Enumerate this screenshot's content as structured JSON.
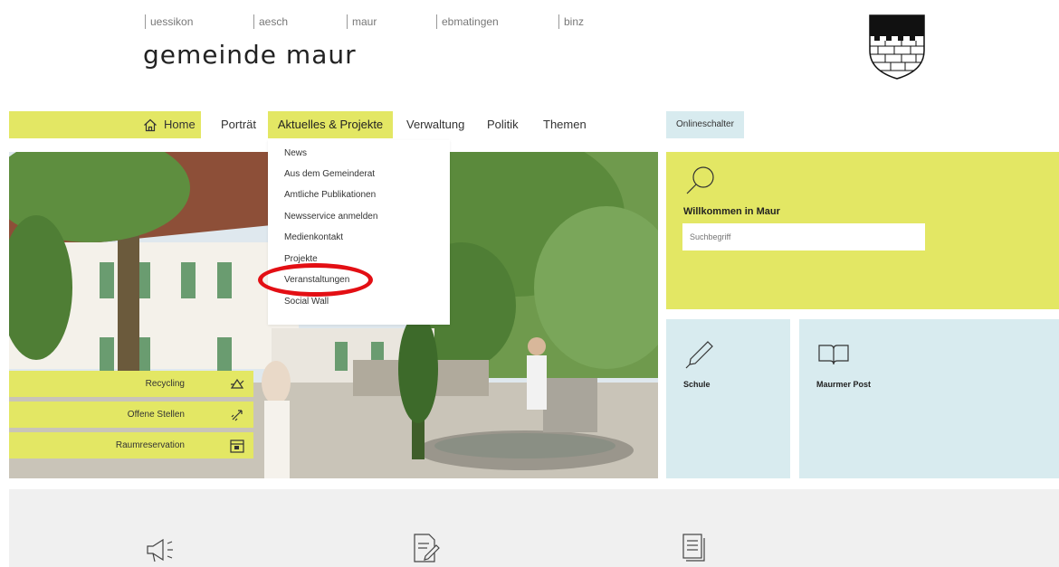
{
  "top_links": [
    "uessikon",
    "aesch",
    "maur",
    "ebmatingen",
    "binz"
  ],
  "brand": "gemeinde maur",
  "nav": {
    "home": "Home",
    "items": [
      "Porträt",
      "Aktuelles & Projekte",
      "Verwaltung",
      "Politik",
      "Themen"
    ],
    "online": "Onlineschalter"
  },
  "dropdown": {
    "items": [
      "News",
      "Aus dem Gemeinderat",
      "Amtliche Publikationen",
      "Newsservice anmelden",
      "Medienkontakt",
      "Projekte",
      "Veranstaltungen",
      "Social Wall"
    ]
  },
  "quick_links": [
    "Recycling",
    "Offene Stellen",
    "Raumreservation"
  ],
  "welcome": {
    "title": "Willkommen in Maur",
    "search_placeholder": "Suchbegriff"
  },
  "tiles": [
    "Schule",
    "Maurmer Post"
  ],
  "colors": {
    "accent": "#e3e764",
    "light_blue": "#d8ebef",
    "highlight": "#e30f14"
  }
}
